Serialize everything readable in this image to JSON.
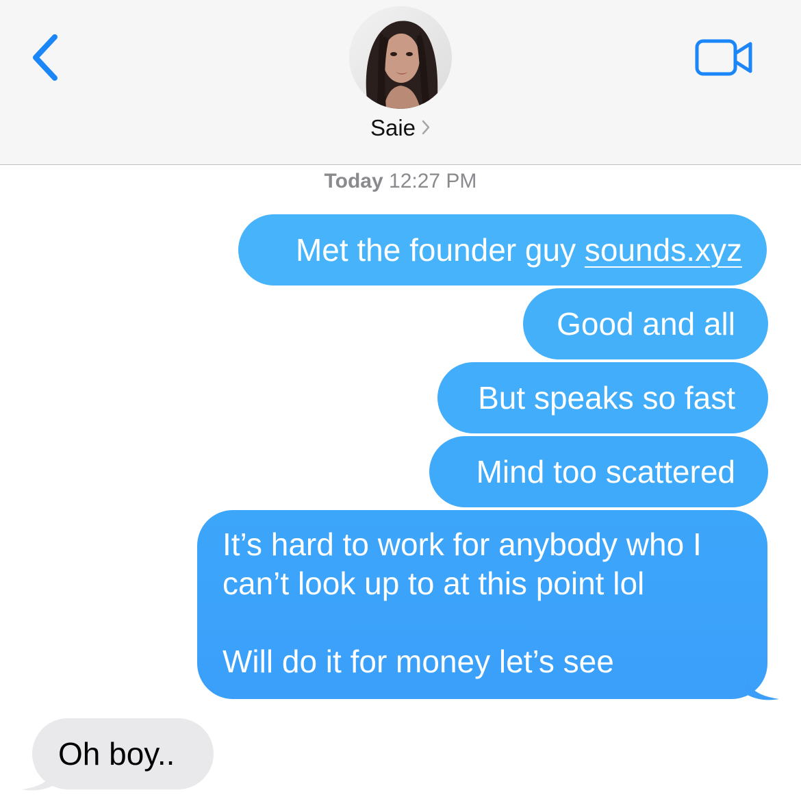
{
  "header": {
    "contact_name": "Saie",
    "back_icon": "chevron-left-icon",
    "video_icon": "video-camera-icon",
    "accent_color": "#1a86f7"
  },
  "timestamp": {
    "day": "Today",
    "time": "12:27 PM"
  },
  "messages": [
    {
      "direction": "sent",
      "text": "Met the founder guy ",
      "link": "sounds.xyz"
    },
    {
      "direction": "sent",
      "text": "Good and all"
    },
    {
      "direction": "sent",
      "text": "But speaks so fast"
    },
    {
      "direction": "sent",
      "text": "Mind too scattered"
    },
    {
      "direction": "sent",
      "paragraphs": [
        "It’s hard to work for anybody who I can’t look up to at this point lol",
        "Will do it for money let’s see"
      ]
    },
    {
      "direction": "received",
      "text": "Oh boy.."
    }
  ],
  "colors": {
    "sent_bubble": "#3ea9fa",
    "received_bubble": "#e9e9eb",
    "header_bg": "#f6f6f6"
  }
}
